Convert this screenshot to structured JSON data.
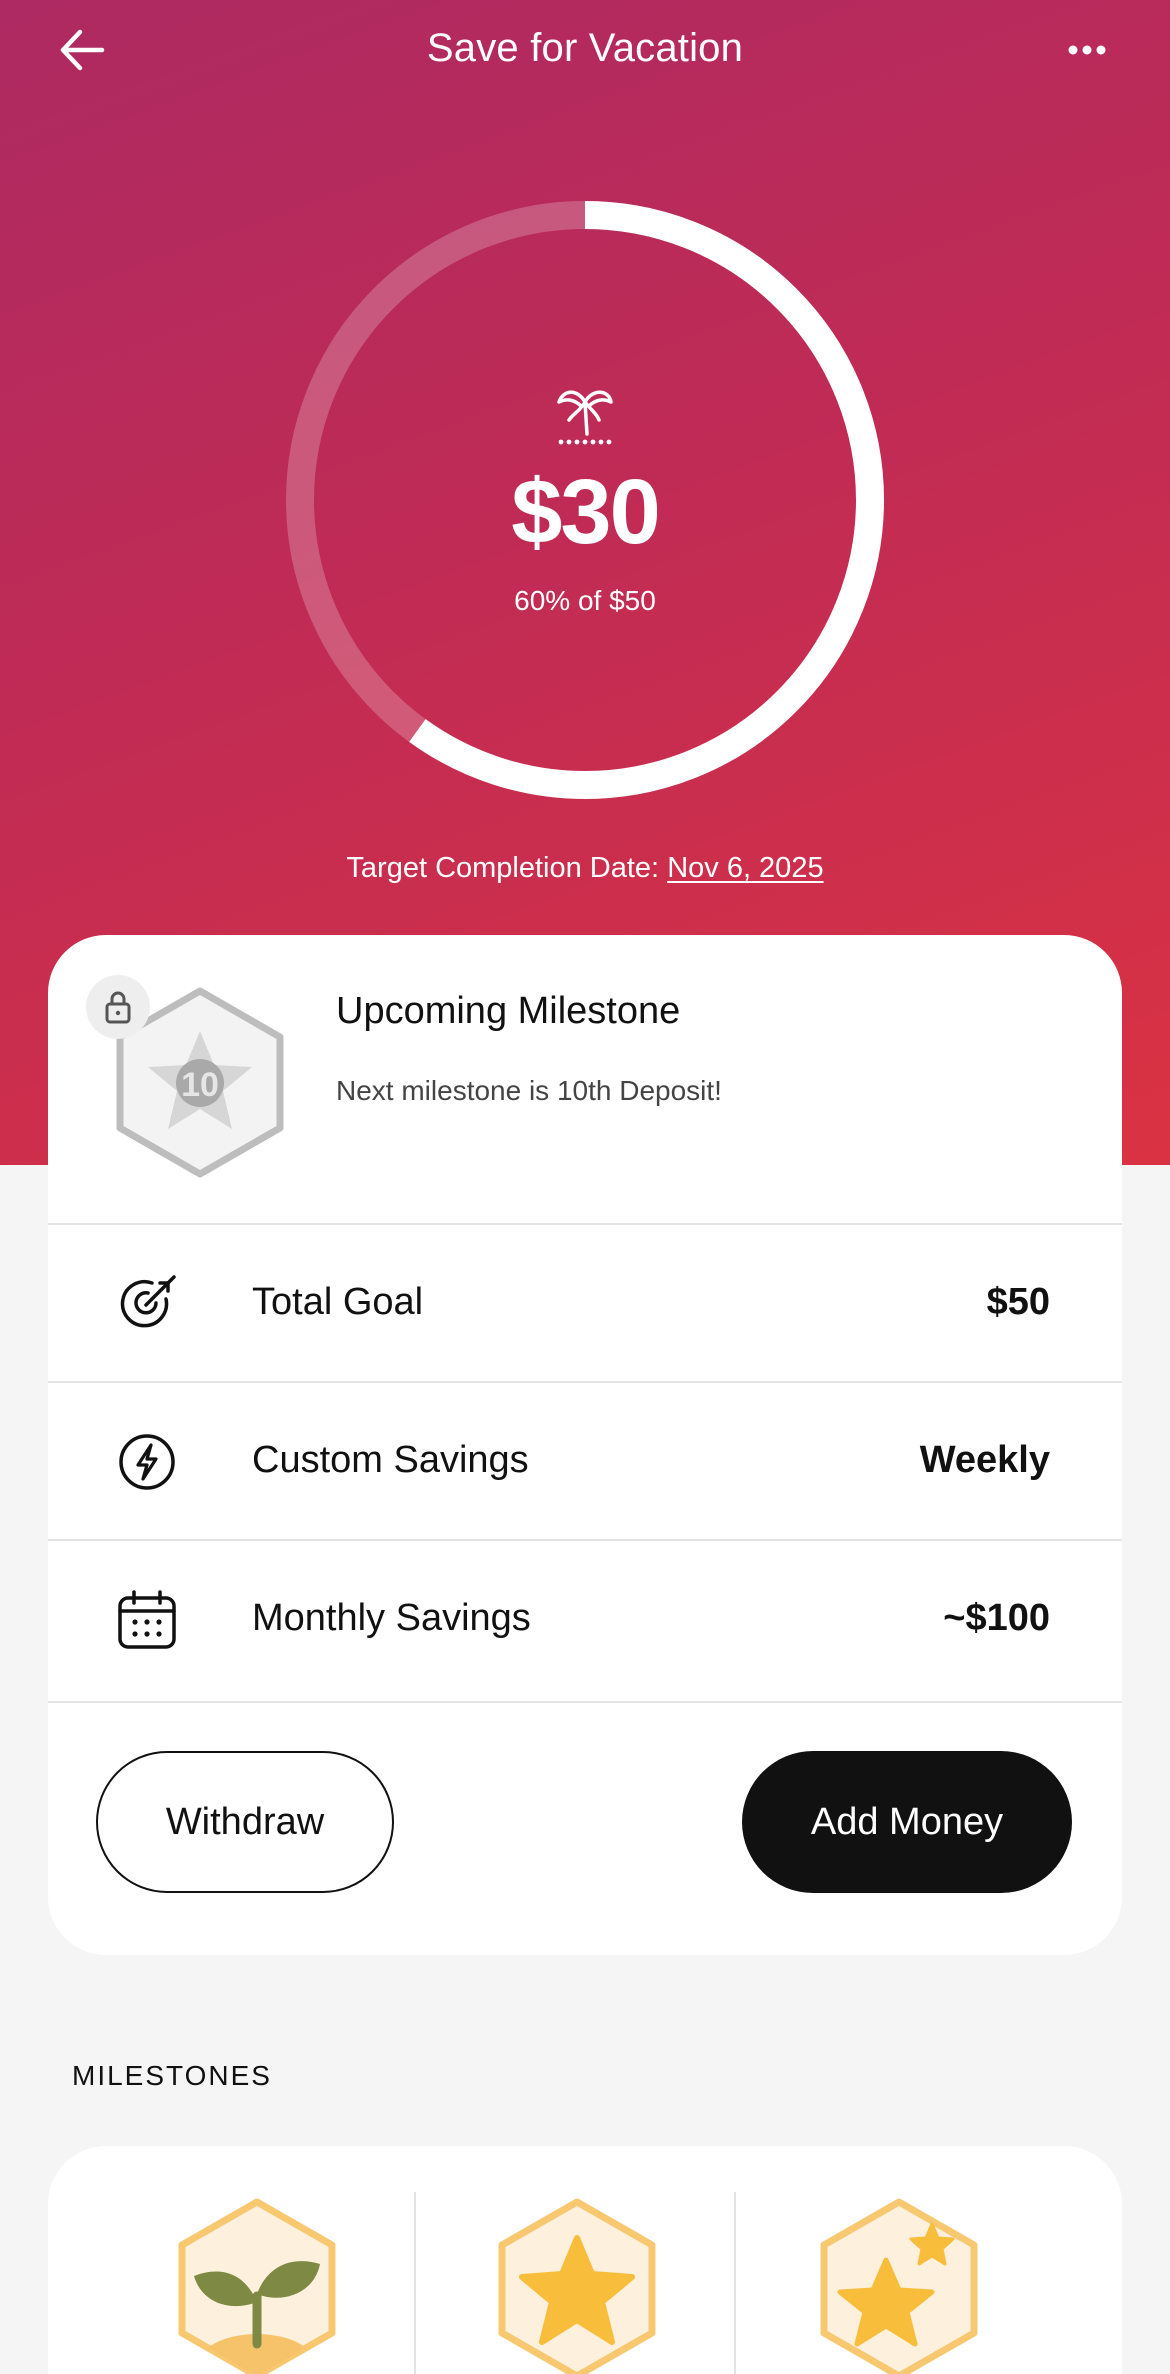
{
  "header": {
    "title": "Save for Vacation",
    "back_icon": "arrow-left-icon",
    "more_icon": "more-horizontal-icon"
  },
  "progress": {
    "icon": "palm-tree-icon",
    "amount": "$30",
    "percent_text": "60% of $50",
    "fraction": 0.6
  },
  "target": {
    "label": "Target Completion Date:",
    "date": "Nov 6, 2025"
  },
  "upcoming_milestone": {
    "title": "Upcoming Milestone",
    "subtitle": "Next milestone is 10th Deposit!",
    "badge_number": "10",
    "badge_icon": "star-badge-icon",
    "lock_icon": "lock-icon"
  },
  "details": [
    {
      "icon": "target-icon",
      "label": "Total Goal",
      "value": "$50"
    },
    {
      "icon": "lightning-icon",
      "label": "Custom Savings",
      "value": "Weekly"
    },
    {
      "icon": "calendar-icon",
      "label": "Monthly Savings",
      "value": "~$100"
    }
  ],
  "actions": {
    "withdraw": "Withdraw",
    "add_money": "Add Money"
  },
  "milestones": {
    "heading": "MILESTONES",
    "badges": [
      {
        "icon": "sprout-badge-icon"
      },
      {
        "icon": "star-badge-icon"
      },
      {
        "icon": "stars-badge-icon"
      }
    ]
  },
  "colors": {
    "hero_start": "#ad2a62",
    "hero_end": "#da3242",
    "button_dark": "#111111",
    "badge_gold": "#f8bd3a"
  }
}
